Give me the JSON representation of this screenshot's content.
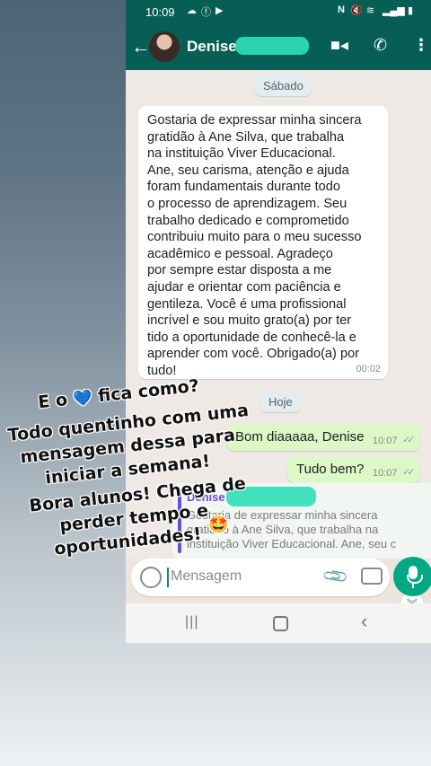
{
  "status_bar": {
    "time": "10:09",
    "left_icons": [
      "cloud-icon",
      "facebook-icon",
      "youtube-icon"
    ],
    "right_icons": [
      "nfc-icon",
      "mute-icon",
      "wifi-icon",
      "signal-icon",
      "battery-icon"
    ]
  },
  "header": {
    "contact_name": "Denise",
    "actions": [
      "video-call-icon",
      "voice-call-icon",
      "more-options-icon"
    ]
  },
  "chat": {
    "day1": "Sábado",
    "message_in": {
      "text": "Gostaria de expressar minha sincera\ngratidão à Ane Silva, que trabalha\nna instituição Viver Educacional.\nAne, seu carisma, atenção e ajuda\nforam fundamentais durante todo\no processo de aprendizagem. Seu\ntrabalho dedicado e comprometido\ncontribuiu muito para o meu sucesso\nacadêmico e pessoal. Agradeço\npor sempre estar disposta a me\najudar e orientar com paciência e\ngentileza. Você é uma profissional\nincrível e sou muito grato(a) por ter\ntido a oportunidade de conhecê-la e\naprender com você. Obrigado(a) por\ntudo!",
      "time": "00:02"
    },
    "day2": "Hoje",
    "messages_out": [
      {
        "text": "Bom diaaaaa, Denise",
        "time": "10:07",
        "status": "read"
      },
      {
        "text": "Tudo bem?",
        "time": "10:07",
        "status": "read"
      }
    ],
    "reply_preview": {
      "name": "Denise",
      "text": "Gostaria de expressar minha sincera\ngratidão à Ane Silva, que trabalha na\ninstituição Viver Educacional. Ane, seu c"
    }
  },
  "composer": {
    "placeholder": "Mensagem"
  },
  "overlay_caption": {
    "line1_pre": "E o",
    "heart": "💙",
    "line1_post": "fica como?",
    "line2": "Todo quentinho com uma",
    "line3": "mensagem dessa para",
    "line4": "iniciar a semana!",
    "line5": "Bora alunos! Chega de",
    "line6": "perder tempo e",
    "line7": "oportunidades!",
    "emoji": "🤩"
  },
  "colors": {
    "header": "#075e54",
    "outgoing_bubble": "#dcf8c6",
    "incoming_bubble": "#ffffff",
    "mic_button": "#00a884",
    "reply_accent": "#6c4fd0"
  }
}
